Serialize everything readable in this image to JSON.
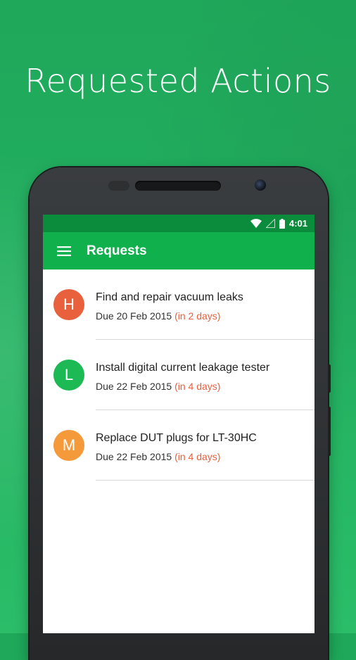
{
  "headline": "Requested Actions",
  "status_bar": {
    "time": "4:01"
  },
  "app_bar": {
    "title": "Requests"
  },
  "colors": {
    "background": "#22b060",
    "status_bar": "#0b8c3c",
    "app_bar": "#10b14d",
    "relative_due": "#e8603c"
  },
  "requests": [
    {
      "initial": "H",
      "avatar_color": "#e8603c",
      "title": "Find and repair vacuum leaks",
      "due": "Due 20 Feb 2015",
      "relative": "(in 2 days)"
    },
    {
      "initial": "L",
      "avatar_color": "#1db954",
      "title": "Install digital current leakage tester",
      "due": "Due 22 Feb 2015",
      "relative": "(in 4 days)"
    },
    {
      "initial": "M",
      "avatar_color": "#f59a3a",
      "title": "Replace DUT plugs for LT-30HC",
      "due": "Due 22 Feb 2015",
      "relative": "(in 4 days)"
    }
  ]
}
